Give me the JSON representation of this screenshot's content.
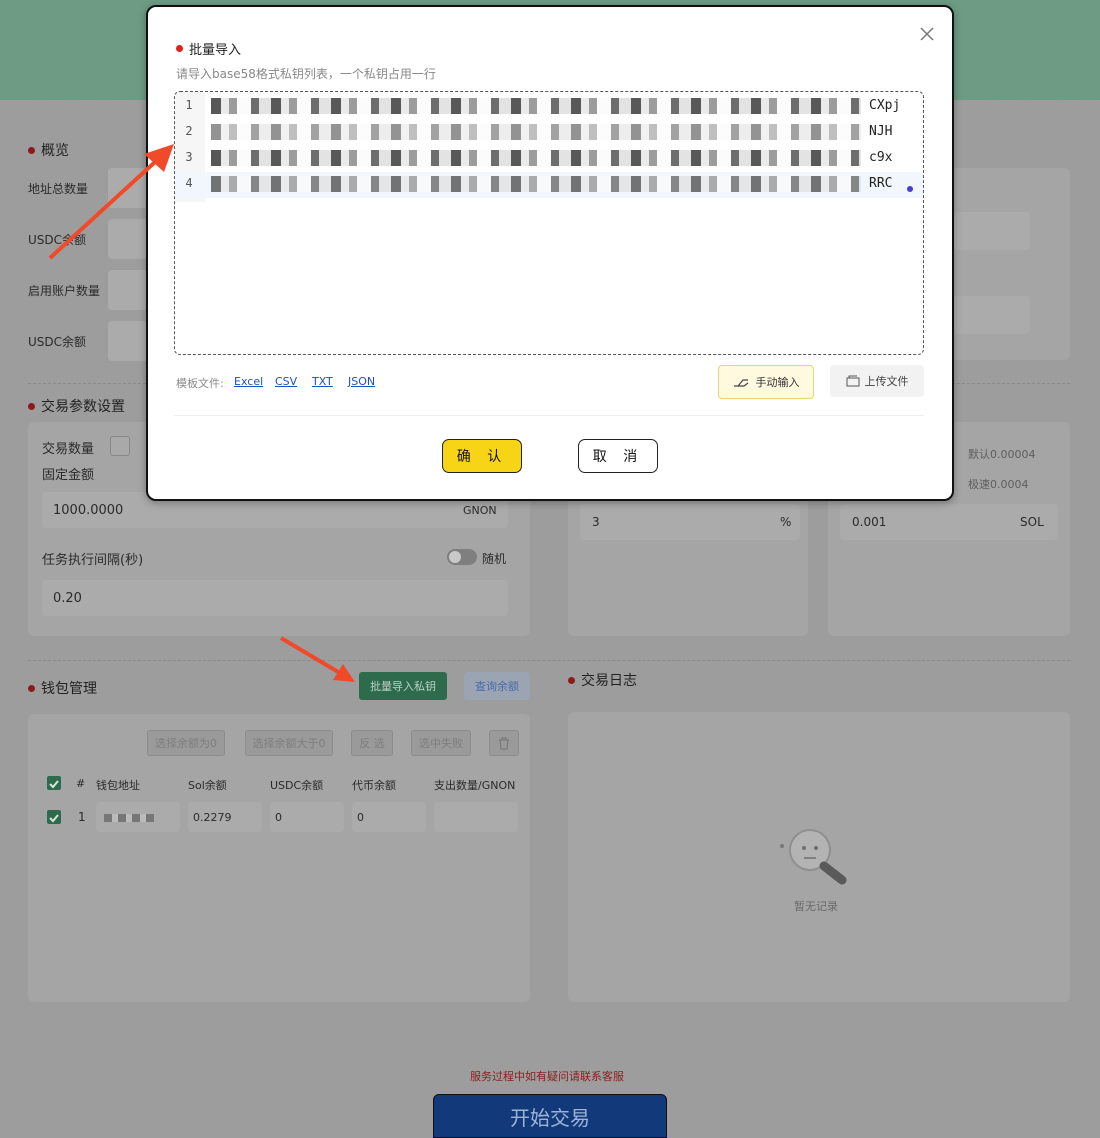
{
  "overview": {
    "title": "概览",
    "rows": [
      "地址总数量",
      "USDC余额",
      "启用账户数量",
      "USDC余额"
    ]
  },
  "trade_params": {
    "title": "交易参数设置",
    "quantity_label": "交易数量",
    "fixed_amount_label": "固定金额",
    "amount_value": "1000.0000",
    "amount_unit": "GNON",
    "interval_label": "任务执行间隔(秒)",
    "random_label": "随机",
    "interval_value": "0.20",
    "slippage_value": "3",
    "slippage_unit": "%",
    "fee_value": "0.001",
    "fee_unit": "SOL",
    "fee_default": "默认0.00004",
    "fee_fast": "极速0.0004"
  },
  "wallet": {
    "title": "钱包管理",
    "batch_import_label": "批量导入私钥",
    "query_balance_label": "查询余额",
    "filter_buttons": [
      "选择余额为0",
      "选择余额大于0",
      "反 选",
      "选中失败"
    ],
    "columns": [
      "#",
      "钱包地址",
      "Sol余额",
      "USDC余额",
      "代币余额",
      "支出数量/GNON"
    ],
    "rows": [
      {
        "index": "1",
        "sol": "0.2279",
        "usdc": "0",
        "token": "0",
        "spend": ""
      }
    ]
  },
  "log": {
    "title": "交易日志",
    "empty_text": "暂无记录"
  },
  "footer": {
    "service_note": "服务过程中如有疑问请联系客服",
    "start_label": "开始交易"
  },
  "modal": {
    "title": "批量导入",
    "subtitle": "请导入base58格式私钥列表，一个私钥占用一行",
    "lines": [
      {
        "num": "1",
        "tail": "CXpj"
      },
      {
        "num": "2",
        "tail": "NJH"
      },
      {
        "num": "3",
        "tail": "c9x"
      },
      {
        "num": "4",
        "tail": "RRC"
      }
    ],
    "template_label": "模板文件:",
    "template_links": [
      "Excel",
      "CSV",
      "TXT",
      "JSON"
    ],
    "manual_input_label": "手动输入",
    "upload_label": "上传文件",
    "confirm_label": "确 认",
    "cancel_label": "取 消"
  }
}
